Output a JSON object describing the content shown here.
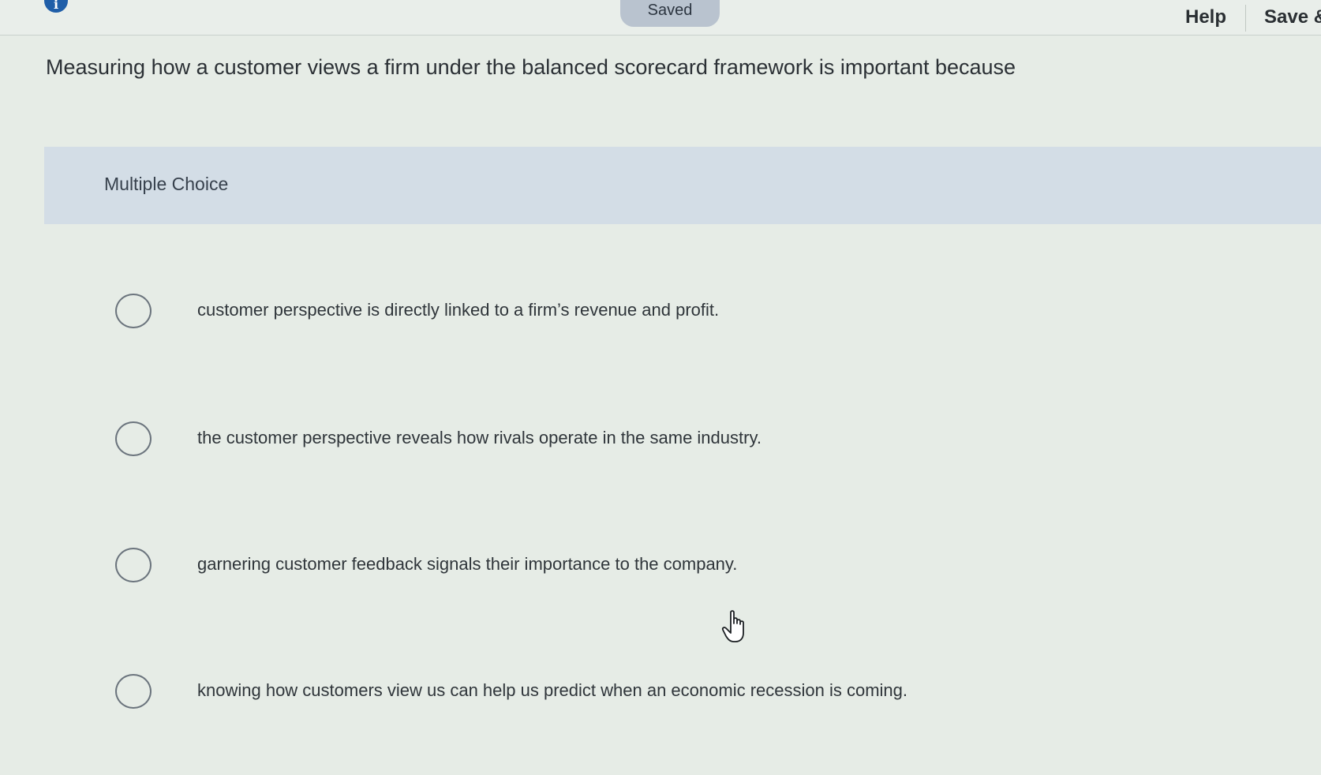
{
  "topbar": {
    "status_pill": "Saved",
    "help_label": "Help",
    "save_label": "Save &"
  },
  "question": {
    "text": "Measuring how a customer views a firm under the balanced scorecard framework is important because"
  },
  "answer_section": {
    "type_label": "Multiple Choice",
    "choices": [
      {
        "label": "customer perspective is directly linked to a firm’s revenue and profit."
      },
      {
        "label": "the customer perspective reveals how rivals operate in the same industry."
      },
      {
        "label": "garnering customer feedback signals their importance to the company."
      },
      {
        "label": "knowing how customers view us can help us predict when an economic recession is coming."
      }
    ]
  },
  "icons": {
    "info": "info-icon",
    "cursor": "hand-pointer-icon"
  },
  "colors": {
    "background": "#e6ece6",
    "multiple_choice_band": "#d3dde6",
    "saved_pill": "#b9c3cf",
    "info_icon": "#1f5ea8"
  }
}
